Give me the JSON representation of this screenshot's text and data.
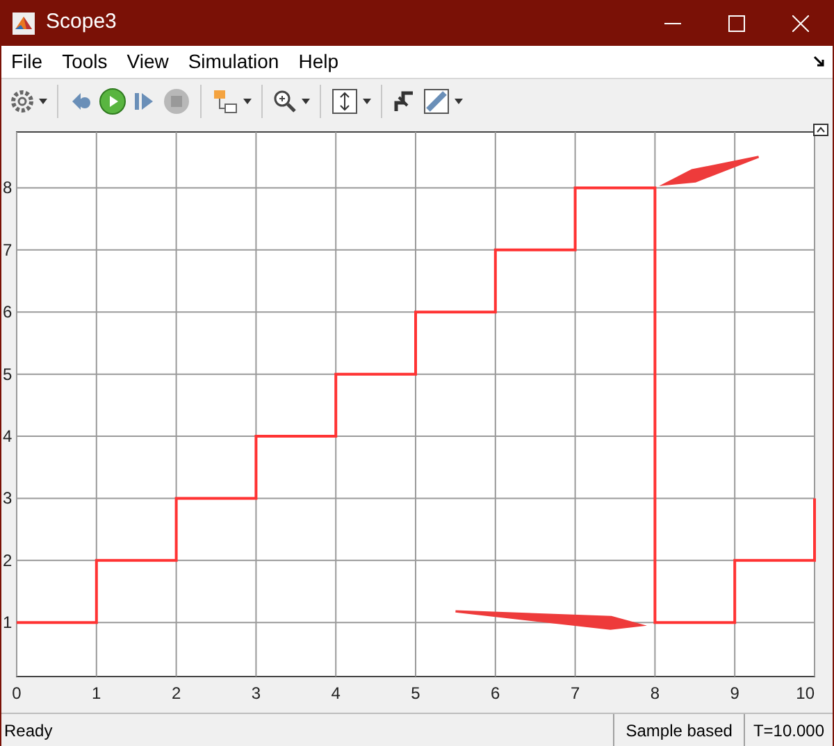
{
  "window": {
    "title": "Scope3"
  },
  "menu": [
    {
      "label": "File"
    },
    {
      "label": "Tools"
    },
    {
      "label": "View"
    },
    {
      "label": "Simulation"
    },
    {
      "label": "Help"
    }
  ],
  "plot": {
    "chart_data": {
      "type": "line",
      "grid": true,
      "x": [
        0,
        1,
        1,
        2,
        2,
        3,
        3,
        4,
        4,
        5,
        5,
        6,
        6,
        7,
        7,
        8,
        8,
        9,
        9,
        10,
        10
      ],
      "xlim": [
        0,
        10
      ],
      "ylim": [
        0.13,
        8.9
      ],
      "xticks": [
        0,
        1,
        2,
        3,
        4,
        5,
        6,
        7,
        8,
        9,
        10
      ],
      "yticks": [
        1,
        2,
        3,
        4,
        5,
        6,
        7,
        8
      ],
      "series": [
        {
          "color": "#ff3333",
          "values": [
            1,
            1,
            2,
            2,
            3,
            3,
            4,
            4,
            5,
            5,
            6,
            6,
            7,
            7,
            8,
            8,
            1,
            1,
            2,
            2,
            3
          ]
        }
      ]
    }
  },
  "status_bar": {
    "text": "Ready",
    "mode": "Sample based",
    "time": "T=10.000"
  }
}
